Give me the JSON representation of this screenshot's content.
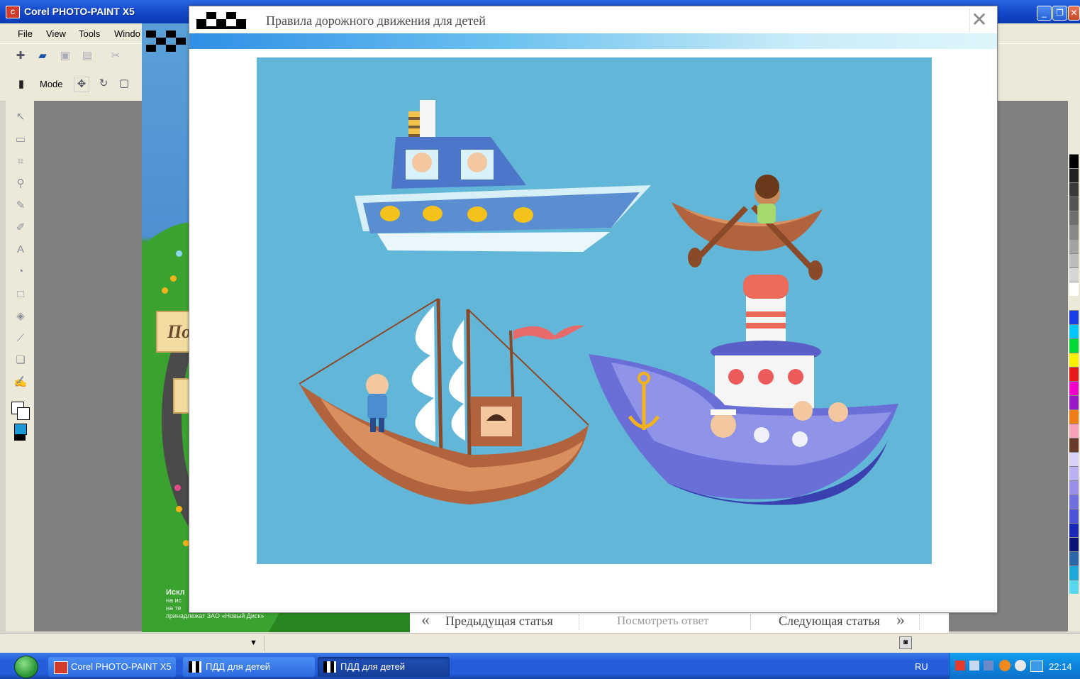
{
  "app": {
    "title": "Corel PHOTO-PAINT X5",
    "icon": "corel-app-icon",
    "window_buttons": [
      "minimize-icon",
      "restore-icon",
      "close-icon"
    ]
  },
  "menu": [
    "File",
    "View",
    "Tools",
    "Windo"
  ],
  "toolbar": {
    "mode_label": "Mode"
  },
  "game_page": {
    "sign_text_1": "По",
    "copyright_lines": [
      "Искл",
      "на ис",
      "на те",
      "принадлежат ЗАО «Новый Диск»"
    ]
  },
  "nav": {
    "prev_icon": "double-chevron-left-icon",
    "prev_label": "Предыдущая статья",
    "answer_label": "Посмотреть ответ",
    "next_label": "Следующая статья",
    "next_icon": "double-chevron-right-icon"
  },
  "modal": {
    "title": "Правила дорожного движения для детей",
    "close_icon": "close-icon",
    "logo": "checker-flag-logo",
    "picture": "illustration-boats-with-children"
  },
  "taskbar": {
    "tasks": [
      {
        "label": "Corel PHOTO-PAINT X5",
        "icon": "corel-app-icon"
      },
      {
        "label": "ПДД для детей",
        "icon": "checker-flag-icon"
      },
      {
        "label": "ПДД для детей",
        "icon": "checker-flag-icon"
      }
    ],
    "language": "RU",
    "clock": "22:14"
  },
  "colors": {
    "sky_picture": "#62b7d8",
    "xp_blue": "#245edb",
    "accent_stripe": "#2e8fe6"
  }
}
